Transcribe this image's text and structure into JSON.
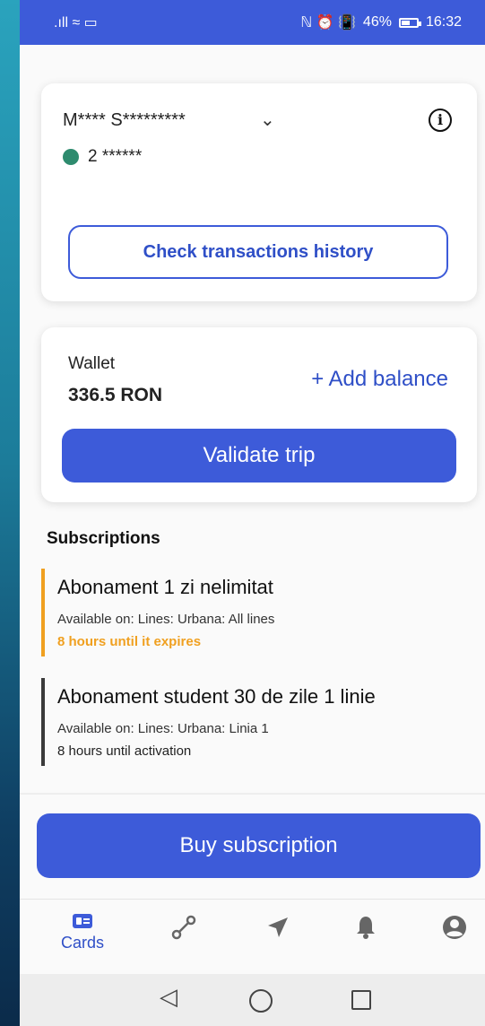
{
  "status_bar": {
    "left": ".ıll ≈ ▭",
    "right_icons": "ℕ ⏰ 📳",
    "battery": "46%",
    "time": "16:32"
  },
  "account": {
    "name": "M**** S*********",
    "number": "2 ******",
    "status_color": "#2e8b6e",
    "history_button": "Check transactions history"
  },
  "wallet": {
    "label": "Wallet",
    "amount": "336.5 RON",
    "add_balance": "+ Add balance",
    "validate_button": "Validate trip"
  },
  "subscriptions": {
    "title": "Subscriptions",
    "items": [
      {
        "name": "Abonament 1 zi nelimitat",
        "availability": "Available on: Lines: Urbana: All lines",
        "status": "8 hours until it expires",
        "accent": "#f0a020"
      },
      {
        "name": "Abonament student 30 de zile 1 linie",
        "availability": "Available on: Lines: Urbana: Linia 1",
        "status": "8 hours until activation",
        "accent": "#3a3a3a"
      }
    ]
  },
  "buy_button": "Buy subscription",
  "bottom_nav": {
    "items": [
      {
        "label": "Cards",
        "icon": "card-icon"
      },
      {
        "icon": "route-icon"
      },
      {
        "icon": "navigation-icon"
      },
      {
        "icon": "bell-icon"
      },
      {
        "icon": "user-icon"
      }
    ]
  },
  "colors": {
    "primary": "#3d5bd9",
    "status_bar": "#3d5bd9"
  }
}
